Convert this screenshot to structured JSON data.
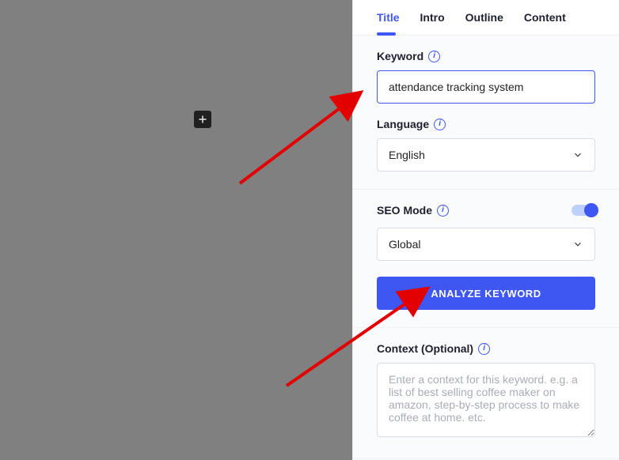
{
  "tabs": {
    "title": "Title",
    "intro": "Intro",
    "outline": "Outline",
    "content": "Content",
    "active": "title"
  },
  "keyword": {
    "label": "Keyword",
    "value": "attendance tracking system"
  },
  "language": {
    "label": "Language",
    "value": "English"
  },
  "seo": {
    "label": "SEO Mode",
    "region_value": "Global",
    "enabled": true
  },
  "analyze_button": "ANALYZE KEYWORD",
  "context": {
    "label": "Context (Optional)",
    "placeholder": "Enter a context for this keyword. e.g. a list of best selling coffee maker on amazon, step-by-step process to make coffee at home. etc.",
    "value": ""
  }
}
